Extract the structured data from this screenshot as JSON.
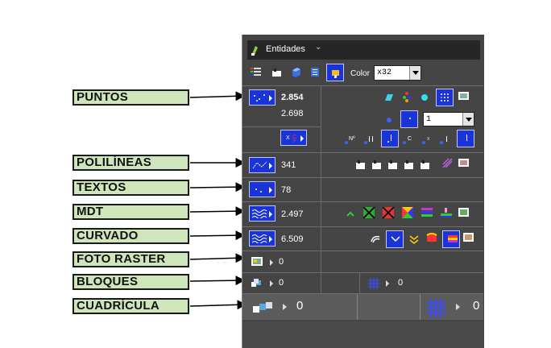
{
  "panel": {
    "title": "Entidades",
    "toolbar": {
      "color_label": "Color",
      "color_value": "x32"
    }
  },
  "rows": {
    "puntos": {
      "count_main": "2.854",
      "count_secondary": "2.698",
      "select_value": "1"
    },
    "polilineas": {
      "count": "341"
    },
    "textos": {
      "count": "78"
    },
    "mdt": {
      "count": "2.497"
    },
    "curvado": {
      "count": "6.509"
    },
    "foto_raster": {
      "count": "0"
    },
    "bloques": {
      "count_left": "0",
      "count_right": "0"
    },
    "cuadricula": {
      "count_left": "0",
      "count_right": "0"
    }
  },
  "callouts": [
    "PUNTOS",
    "POLILÍNEAS",
    "TEXTOS",
    "MDT",
    "CURVADO",
    "FOTO RASTER",
    "BLOQUES",
    "CUADRÍCULA"
  ],
  "colors": {
    "panel_bg": "#454545",
    "button_blue": "#1b34d8",
    "callout_bg": "#cfe6bd"
  }
}
